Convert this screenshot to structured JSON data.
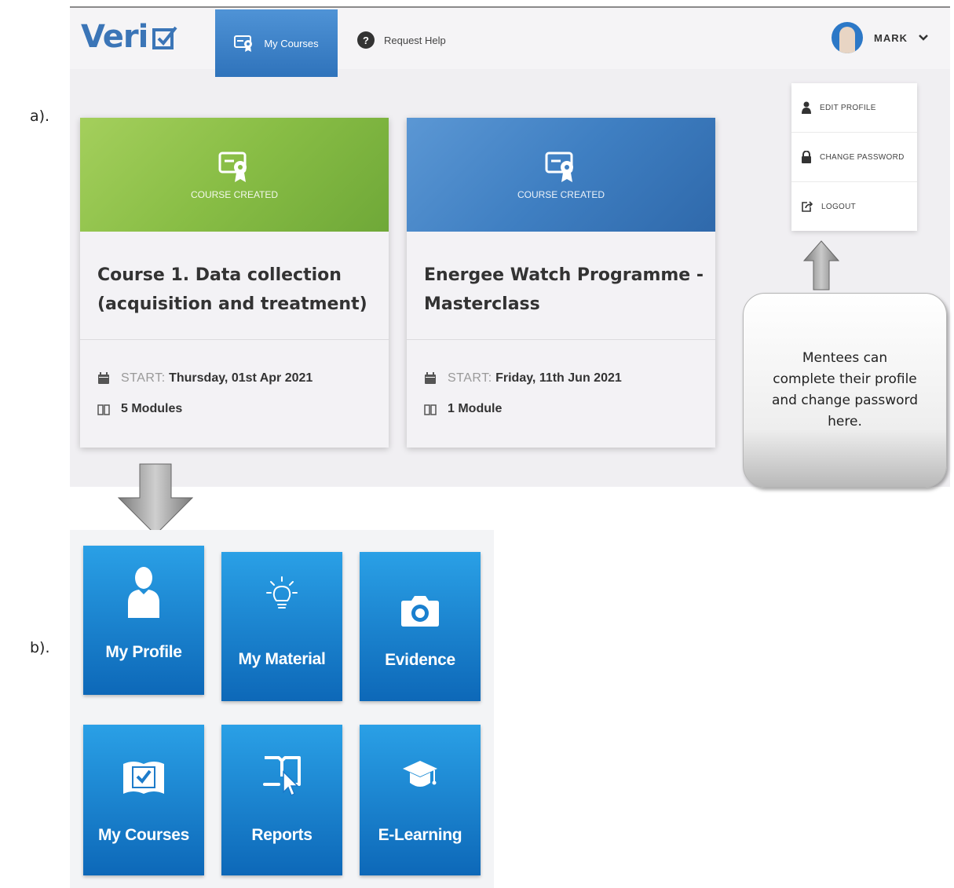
{
  "labels": {
    "a": "a).",
    "b": "b)."
  },
  "app": {
    "logo_text": "Veri"
  },
  "nav": {
    "courses_label": "My Courses",
    "help_label": "Request Help",
    "help_glyph": "?",
    "user_name": "MARK",
    "chevron": "❯"
  },
  "dropdown": {
    "items": [
      {
        "label": "EDIT PROFILE",
        "icon": "user-icon"
      },
      {
        "label": "CHANGE PASSWORD",
        "icon": "lock-icon"
      },
      {
        "label": "LOGOUT",
        "icon": "logout-icon"
      }
    ]
  },
  "courses": [
    {
      "banner_status": "COURSE CREATED",
      "title": "Course 1. Data collection (acquisition and treatment)",
      "start_label": "START:",
      "start_date": "Thursday, 01st Apr 2021",
      "modules": "5 Modules",
      "banner_color": "#8bbf4a"
    },
    {
      "banner_status": "COURSE CREATED",
      "title": "Energee Watch Programme - Masterclass",
      "start_label": "START:",
      "start_date": "Friday, 11th Jun 2021",
      "modules": "1 Module",
      "banner_color": "#4a86c8"
    }
  ],
  "callout": {
    "text": "Mentees can complete their profile and change password here."
  },
  "tiles": [
    {
      "label": "My Profile",
      "icon": "person-icon"
    },
    {
      "label": "My Material",
      "icon": "lightbulb-icon"
    },
    {
      "label": "Evidence",
      "icon": "camera-icon"
    },
    {
      "label": "My Courses",
      "icon": "checked-book-icon"
    },
    {
      "label": "Reports",
      "icon": "book-cursor-icon"
    },
    {
      "label": "E-Learning",
      "icon": "graduation-cap-icon"
    }
  ],
  "colors": {
    "accent": "#2f73bb",
    "tile_top": "#2aa0e6",
    "tile_bottom": "#0d68b8",
    "logo": "#3b75b7"
  }
}
